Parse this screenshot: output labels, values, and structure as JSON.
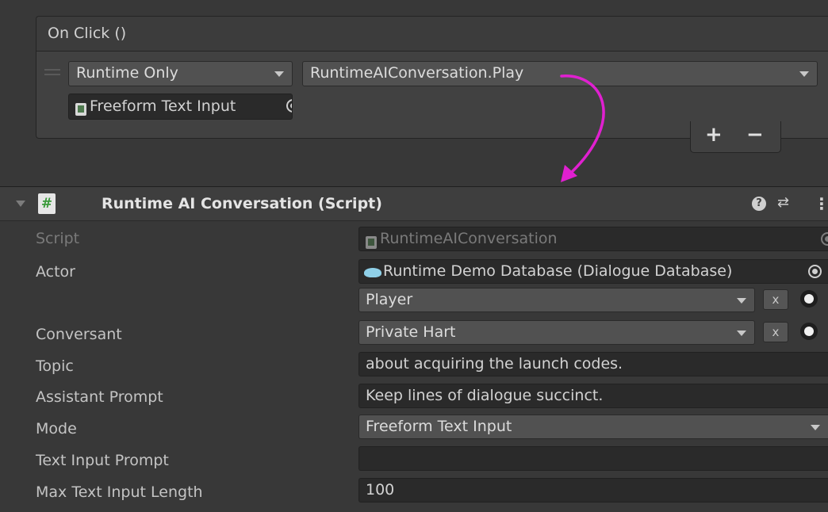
{
  "event": {
    "title": "On Click ()",
    "runtime_dropdown": "Runtime Only",
    "method_dropdown": "RuntimeAIConversation.Play",
    "target_object": "Freeform Text Input",
    "plus_label": "+",
    "minus_label": "−"
  },
  "component": {
    "title": "Runtime AI Conversation (Script)",
    "script_icon_label": "#",
    "help_label": "?",
    "presets_label": "⇄",
    "menu_label": "⋮"
  },
  "properties": {
    "script": {
      "label": "Script",
      "value": "RuntimeAIConversation"
    },
    "actor": {
      "label": "Actor",
      "database": "Runtime Demo Database (Dialogue Database)",
      "selection": "Player",
      "clear_label": "x"
    },
    "conversant": {
      "label": "Conversant",
      "selection": "Private Hart",
      "clear_label": "x"
    },
    "topic": {
      "label": "Topic",
      "value": "about acquiring the launch codes."
    },
    "assistant_prompt": {
      "label": "Assistant Prompt",
      "value": "Keep lines of dialogue succinct."
    },
    "mode": {
      "label": "Mode",
      "value": "Freeform Text Input"
    },
    "text_input_prompt": {
      "label": "Text Input Prompt",
      "value": ""
    },
    "max_text_input_length": {
      "label": "Max Text Input Length",
      "value": "100"
    }
  },
  "colors": {
    "background": "#383838",
    "field": "#2a2a2a",
    "dropdown": "#515151",
    "annotation_arrow": "#e020d0"
  }
}
